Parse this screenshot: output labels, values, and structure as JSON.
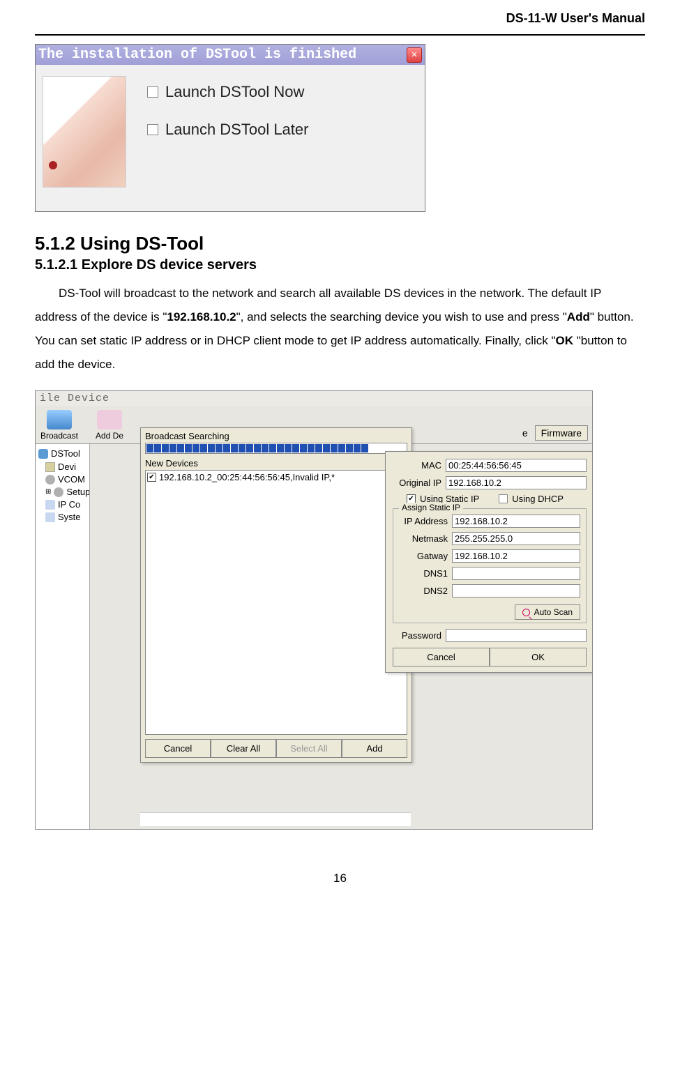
{
  "header": {
    "title": "DS-11-W User's Manual"
  },
  "installer": {
    "title": "The installation of DSTool is finished",
    "option1": "Launch DSTool Now",
    "option2": "Launch DSTool Later"
  },
  "section": {
    "h1": "5.1.2    Using DS-Tool",
    "h2": "5.1.2.1   Explore DS device servers",
    "p1a": "DS-Tool will broadcast to the network and search all available DS devices in the network. The default IP address of the device is \"",
    "p1b": "192.168.10.2",
    "p1c": "\", and selects the searching device you wish to use and press \"",
    "p1d": "Add",
    "p1e": "\" button.   You can set static IP address or in DHCP client mode to get IP address automatically.   Finally, click \"",
    "p1f": "OK",
    "p1g": " \"button to add the device."
  },
  "dstool": {
    "menubar": "ile  Device",
    "toolbar": {
      "broadcast": "Broadcast",
      "add": "Add De",
      "firmware": "Firmware",
      "ce_partial": "e"
    },
    "tree": {
      "root": "DSTool",
      "items": [
        "Devi",
        "VCOM",
        "Setup",
        "IP Co",
        "Syste"
      ]
    },
    "search": {
      "title": "Broadcast Searching",
      "new_devices": "New Devices",
      "device_row": "192.168.10.2_00:25:44:56:56:45,Invalid IP,*",
      "buttons": {
        "cancel": "Cancel",
        "clear_all": "Clear All",
        "select_all": "Select All",
        "add": "Add"
      }
    },
    "config": {
      "mac_label": "MAC",
      "mac_value": "00:25:44:56:56:45",
      "origip_label": "Original IP",
      "origip_value": "192.168.10.2",
      "use_static": "Using Static IP",
      "use_dhcp": "Using DHCP",
      "group_legend": "Assign Static IP",
      "ip_label": "IP Address",
      "ip_value": "192.168.10.2",
      "netmask_label": "Netmask",
      "netmask_value": "255.255.255.0",
      "gateway_label": "Gatway",
      "gateway_value": "192.168.10.2",
      "dns1_label": "DNS1",
      "dns1_value": "",
      "dns2_label": "DNS2",
      "dns2_value": "",
      "auto_scan": "Auto Scan",
      "password_label": "Password",
      "password_value": "",
      "buttons": {
        "cancel": "Cancel",
        "ok": "OK"
      }
    }
  },
  "page_number": "16"
}
